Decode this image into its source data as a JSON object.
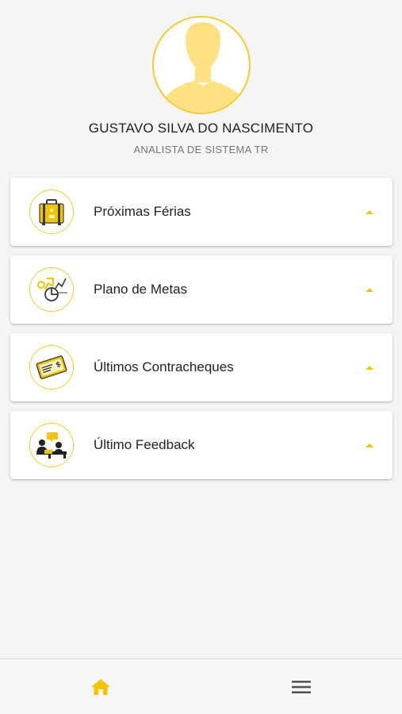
{
  "profile": {
    "name": "GUSTAVO SILVA DO NASCIMENTO",
    "role": "ANALISTA DE SISTEMA TR"
  },
  "menu": {
    "items": [
      {
        "label": "Próximas Férias",
        "icon": "suitcase-icon"
      },
      {
        "label": "Plano de Metas",
        "icon": "goals-chart-icon"
      },
      {
        "label": "Últimos Contracheques",
        "icon": "paycheck-icon"
      },
      {
        "label": "Último Feedback",
        "icon": "feedback-meeting-icon"
      }
    ]
  },
  "bottom_nav": {
    "items": [
      {
        "icon": "home-icon",
        "active": true
      },
      {
        "icon": "menu-icon",
        "active": false
      }
    ]
  },
  "colors": {
    "accent": "#f5c400",
    "accent_light": "#ffe082",
    "background": "#f4f4f4"
  }
}
